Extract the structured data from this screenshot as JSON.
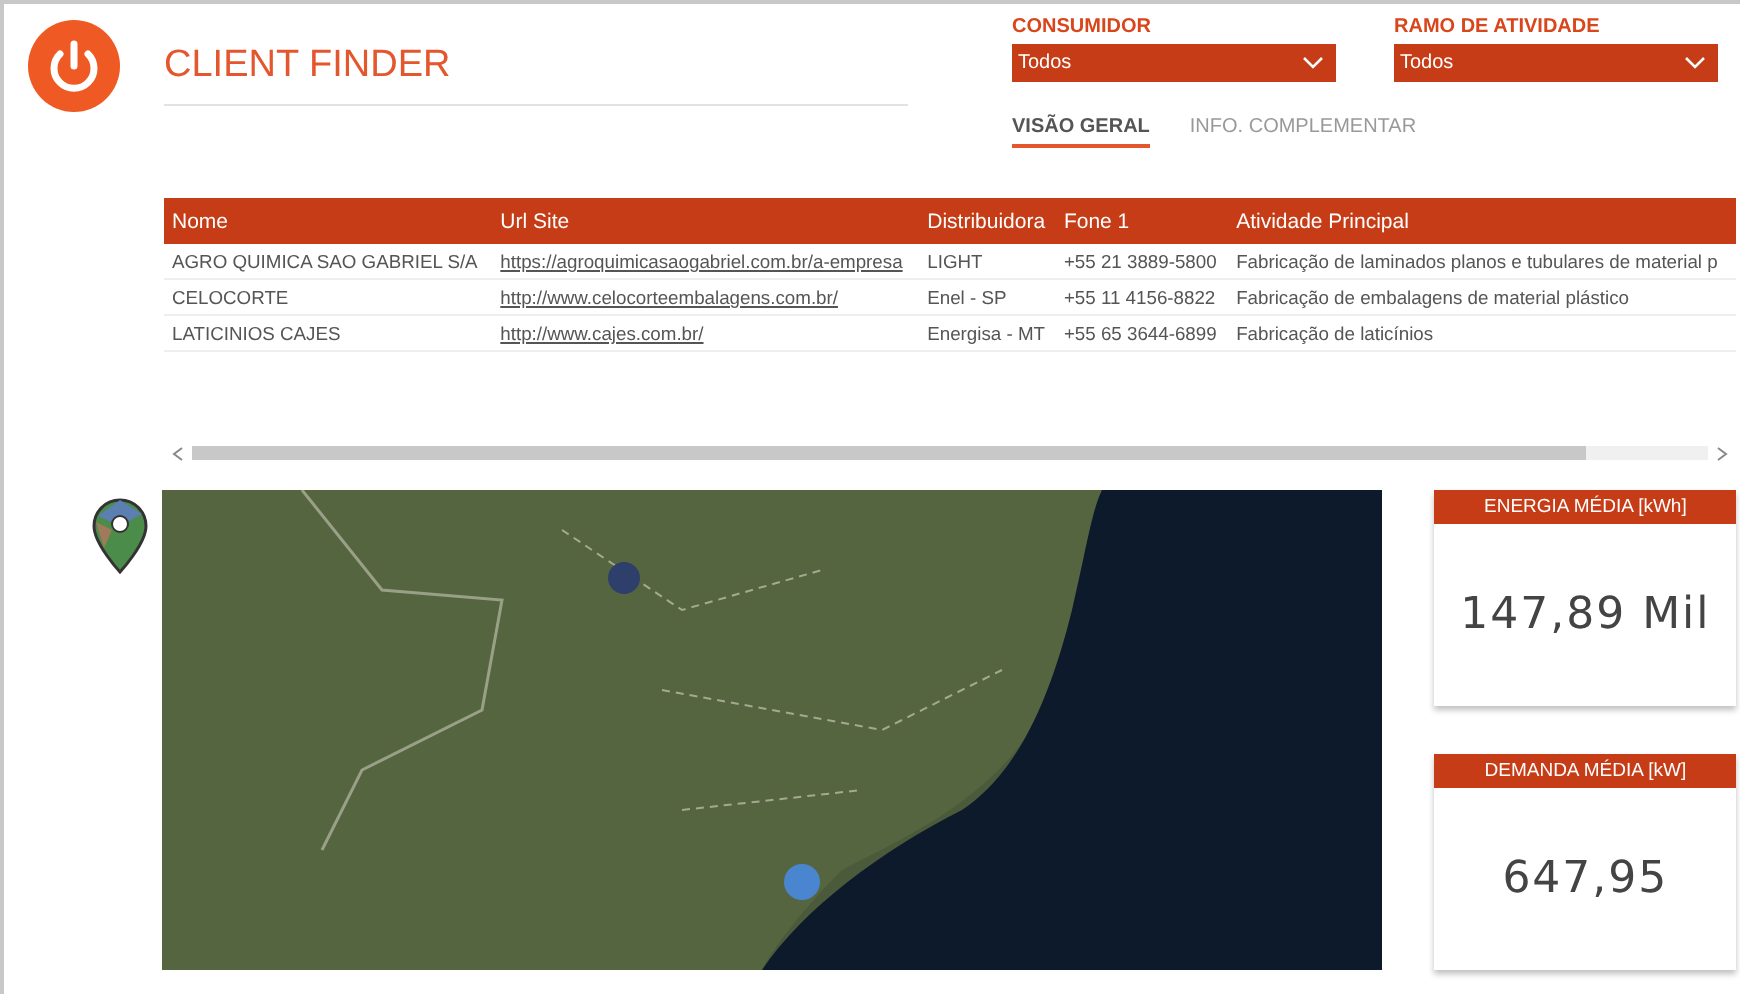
{
  "header": {
    "title": "CLIENT FINDER"
  },
  "filters": [
    {
      "label": "CONSUMIDOR",
      "value": "Todos"
    },
    {
      "label": "RAMO DE ATIVIDADE",
      "value": "Todos"
    }
  ],
  "tabs": [
    {
      "label": "VISÃO GERAL",
      "selected": true
    },
    {
      "label": "INFO. COMPLEMENTAR",
      "selected": false
    }
  ],
  "table": {
    "columns": [
      "Nome",
      "Url Site",
      "Distribuidora",
      "Fone 1",
      "Atividade Principal"
    ],
    "rows": [
      [
        "AGRO QUIMICA SAO GABRIEL S/A",
        "https://agroquimicasaogabriel.com.br/a-empresa",
        "LIGHT",
        "+55 21 3889-5800",
        "Fabricação de laminados planos e tubulares de material p"
      ],
      [
        "CELOCORTE",
        "http://www.celocorteembalagens.com.br/",
        "Enel - SP",
        "+55 11 4156-8822",
        "Fabricação de embalagens de material plástico"
      ],
      [
        "LATICINIOS CAJES",
        "http://www.cajes.com.br/",
        "Energisa - MT",
        "+55 65 3644-6899",
        "Fabricação de laticínios"
      ]
    ]
  },
  "cards": [
    {
      "title": "ENERGIA MÉDIA [kWh]",
      "value": "147,89 Mil"
    },
    {
      "title": "DEMANDA MÉDIA [kW]",
      "value": "647,95"
    }
  ]
}
